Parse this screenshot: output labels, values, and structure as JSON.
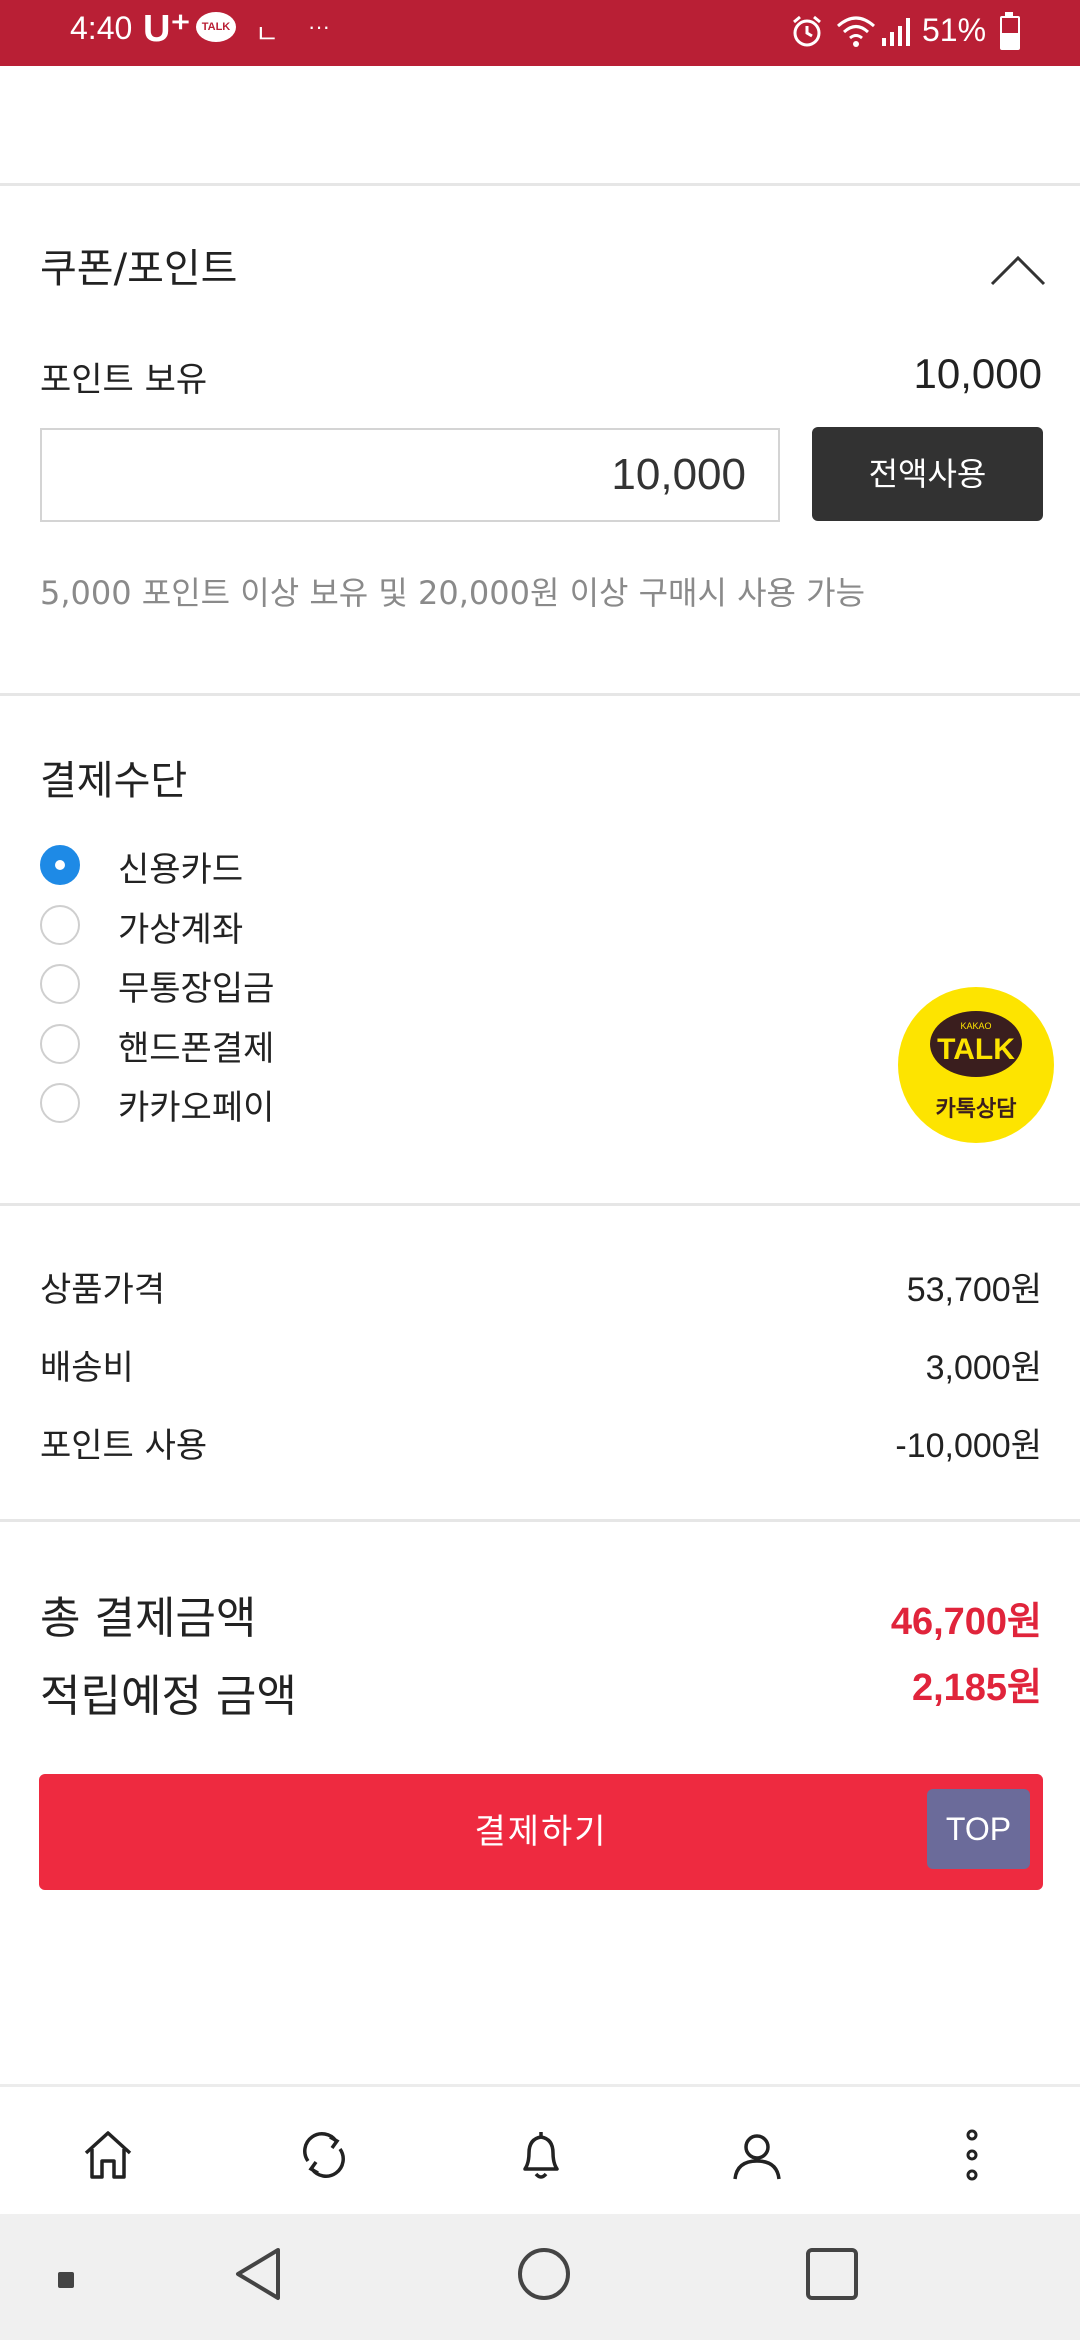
{
  "status_bar": {
    "time": "4:40",
    "carrier": "U⁺",
    "talk_badge": "TALK",
    "misc": "ㄴ",
    "dots": "···",
    "battery": "51%"
  },
  "coupon_section": {
    "title": "쿠폰/포인트",
    "points_label": "포인트 보유",
    "points_value": "10,000",
    "input_value": "10,000",
    "use_all_label": "전액사용",
    "notice": "5,000 포인트 이상 보유 및 20,000원 이상 구매시 사용 가능"
  },
  "payment_section": {
    "title": "결제수단",
    "methods": [
      {
        "label": "신용카드",
        "selected": true
      },
      {
        "label": "가상계좌",
        "selected": false
      },
      {
        "label": "무통장입금",
        "selected": false
      },
      {
        "label": "핸드폰결제",
        "selected": false
      },
      {
        "label": "카카오페이",
        "selected": false
      }
    ]
  },
  "kakao": {
    "small": "KAKAO",
    "big": "TALK",
    "label": "카톡상담"
  },
  "summary": {
    "rows": [
      {
        "label": "상품가격",
        "value": "53,700원"
      },
      {
        "label": "배송비",
        "value": "3,000원"
      },
      {
        "label": "포인트 사용",
        "value": "-10,000원"
      }
    ]
  },
  "totals": {
    "total_label": "총 결제금액",
    "total_value": "46,700원",
    "reward_label": "적립예정 금액",
    "reward_value": "2,185원"
  },
  "actions": {
    "pay_label": "결제하기",
    "top_label": "TOP"
  },
  "bottom_nav": {
    "icons": [
      "home-icon",
      "refresh-icon",
      "bell-icon",
      "user-icon",
      "more-icon"
    ]
  },
  "colors": {
    "status_bar": "#b91f35",
    "accent_red": "#ee2a40",
    "price_red": "#e0243b",
    "radio_blue": "#1e8ae6",
    "kakao_yellow": "#fde400",
    "top_button": "#6b6b9a"
  }
}
